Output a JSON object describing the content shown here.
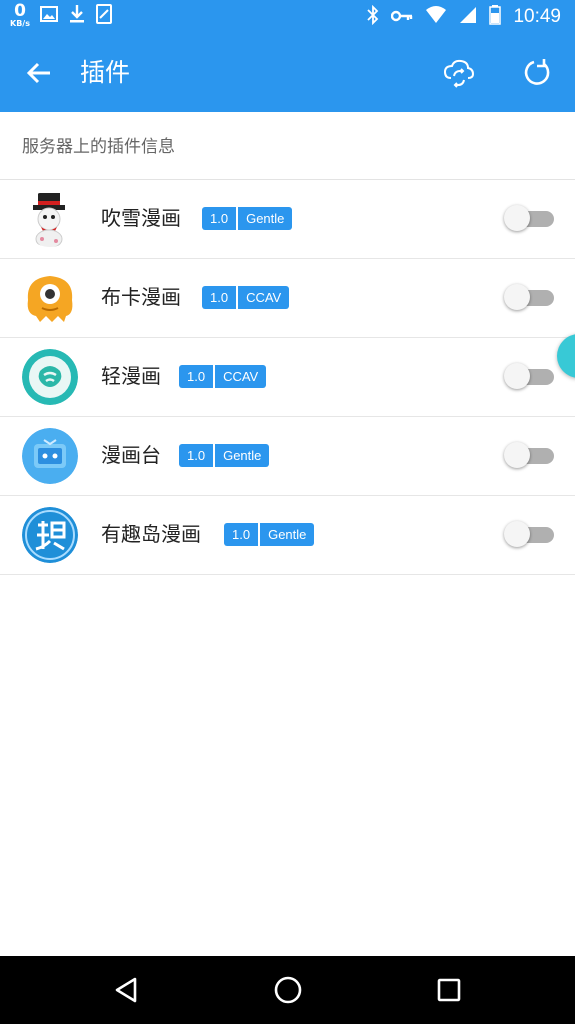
{
  "status_bar": {
    "net_speed": "0",
    "net_unit": "KB/s",
    "time": "10:49",
    "left_icons": [
      "image-icon",
      "download-icon",
      "screenshot-icon"
    ],
    "right_icons": [
      "bluetooth-icon",
      "key-icon",
      "wifi-icon",
      "signal-icon",
      "battery-icon"
    ]
  },
  "toolbar": {
    "title": "插件",
    "back_icon": "arrow-left-icon",
    "cloud_icon": "cloud-sync-icon",
    "refresh_icon": "refresh-icon",
    "color": "#2b96ee"
  },
  "section": {
    "header": "服务器上的插件信息"
  },
  "plugins": [
    {
      "name": "吹雪漫画",
      "version": "1.0",
      "source": "Gentle",
      "enabled": false,
      "icon": "snowman-avatar"
    },
    {
      "name": "布卡漫画",
      "version": "1.0",
      "source": "CCAV",
      "enabled": false,
      "icon": "orange-monster-avatar"
    },
    {
      "name": "轻漫画",
      "version": "1.0",
      "source": "CCAV",
      "enabled": false,
      "icon": "teal-leaf-avatar"
    },
    {
      "name": "漫画台",
      "version": "1.0",
      "source": "Gentle",
      "enabled": false,
      "icon": "blue-tv-avatar"
    },
    {
      "name": "有趣岛漫画",
      "version": "1.0",
      "source": "Gentle",
      "enabled": false,
      "icon": "qu-character-avatar"
    }
  ],
  "nav_bar": {
    "back_icon": "nav-back-icon",
    "home_icon": "nav-home-icon",
    "recents_icon": "nav-recents-icon"
  }
}
